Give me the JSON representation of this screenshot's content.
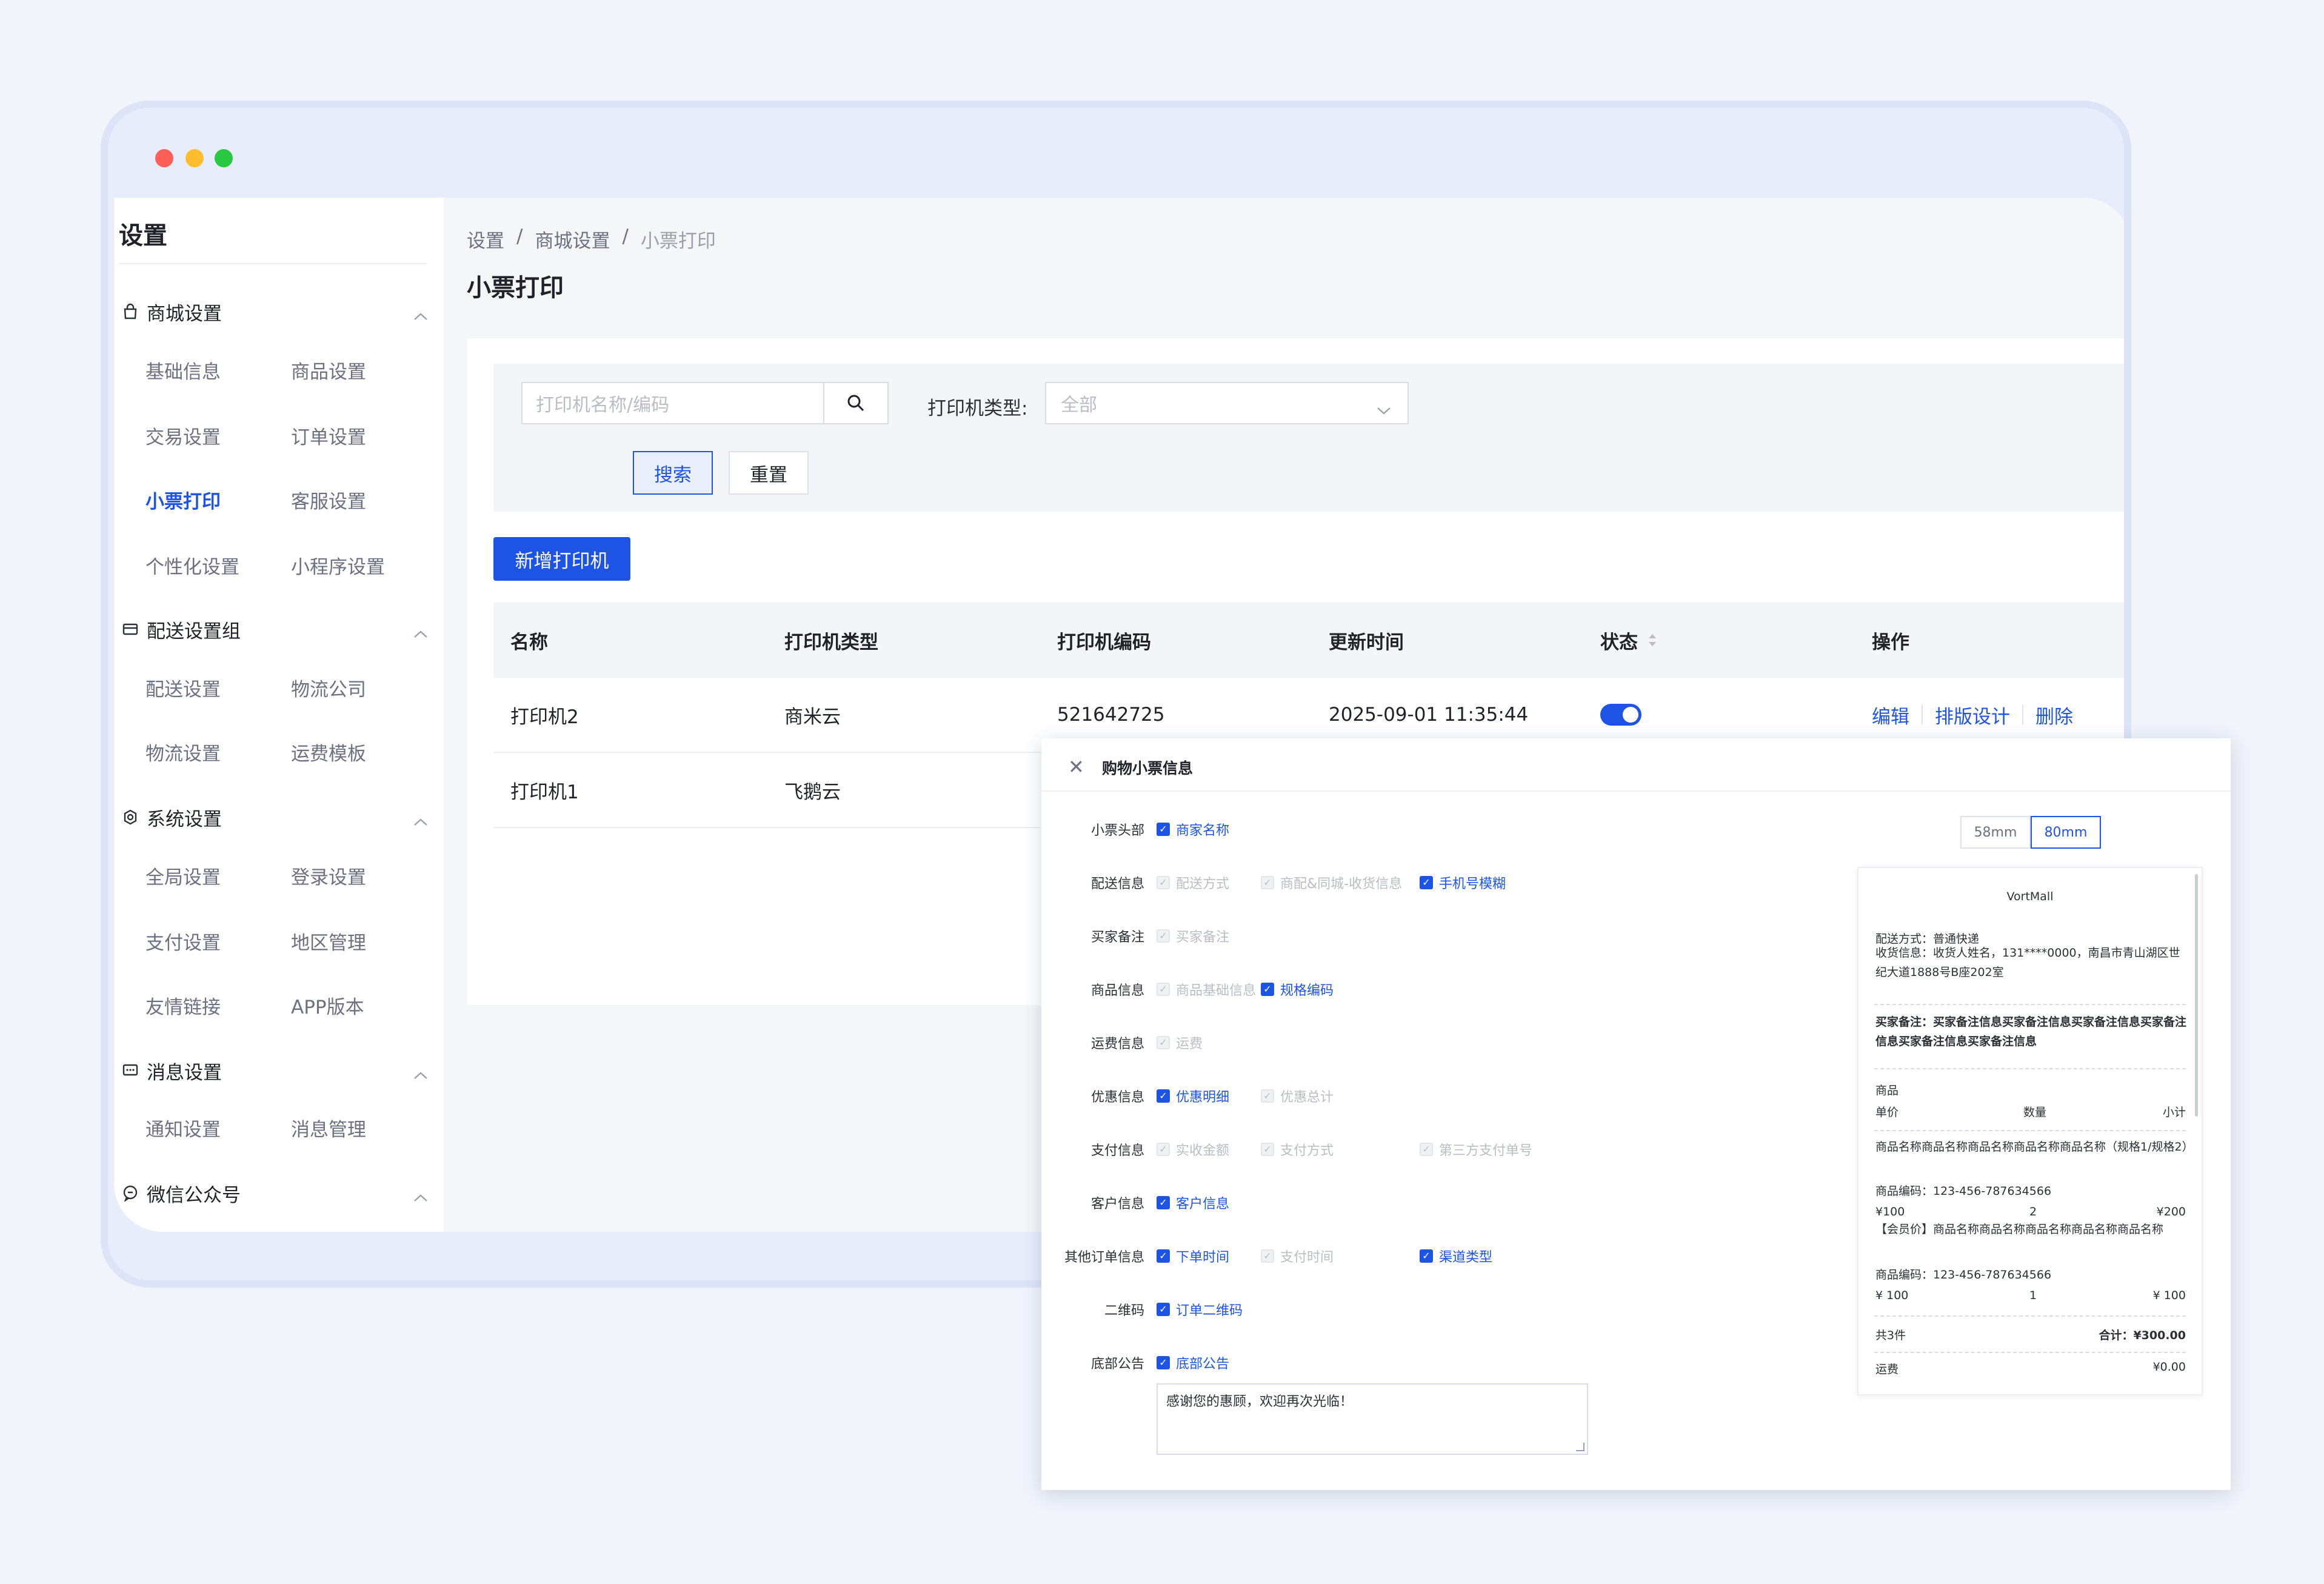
{
  "sidebar": {
    "title": "设置",
    "groups": [
      {
        "label": "商城设置",
        "items": [
          "基础信息",
          "商品设置",
          "交易设置",
          "订单设置",
          "小票打印",
          "客服设置",
          "个性化设置",
          "小程序设置"
        ]
      },
      {
        "label": "配送设置组",
        "items": [
          "配送设置",
          "物流公司",
          "物流设置",
          "运费模板"
        ]
      },
      {
        "label": "系统设置",
        "items": [
          "全局设置",
          "登录设置",
          "支付设置",
          "地区管理",
          "友情链接",
          "APP版本"
        ]
      },
      {
        "label": "消息设置",
        "items": [
          "通知设置",
          "消息管理"
        ]
      },
      {
        "label": "微信公众号",
        "items": []
      }
    ],
    "active_item": "小票打印"
  },
  "breadcrumb": [
    "设置",
    "商城设置",
    "小票打印"
  ],
  "breadcrumb_sep": "/",
  "page_title": "小票打印",
  "filter": {
    "search_placeholder": "打印机名称/编码",
    "type_label": "打印机类型:",
    "type_value": "全部",
    "search_button": "搜索",
    "reset_button": "重置"
  },
  "add_button": "新增打印机",
  "table": {
    "headers": [
      "名称",
      "打印机类型",
      "打印机编码",
      "更新时间",
      "状态",
      "操作"
    ],
    "rows": [
      {
        "name": "打印机2",
        "type": "商米云",
        "code": "521642725",
        "updated": "2025-09-01 11:35:44",
        "enabled": true
      },
      {
        "name": "打印机1",
        "type": "飞鹅云",
        "code": "",
        "updated": "",
        "enabled": null
      }
    ],
    "actions": [
      "编辑",
      "排版设计",
      "删除"
    ]
  },
  "popup": {
    "title": "购物小票信息",
    "sizes": [
      "58mm",
      "80mm"
    ],
    "active_size": "80mm",
    "rows": [
      {
        "label": "小票头部",
        "options": [
          {
            "text": "商家名称",
            "state": "on"
          }
        ]
      },
      {
        "label": "配送信息",
        "options": [
          {
            "text": "配送方式",
            "state": "dis"
          },
          {
            "text": "商配&同城-收货信息",
            "state": "dis"
          },
          {
            "text": "手机号模糊",
            "state": "on"
          }
        ]
      },
      {
        "label": "买家备注",
        "options": [
          {
            "text": "买家备注",
            "state": "dis"
          }
        ]
      },
      {
        "label": "商品信息",
        "options": [
          {
            "text": "商品基础信息",
            "state": "dis"
          },
          {
            "text": "规格编码",
            "state": "on"
          }
        ]
      },
      {
        "label": "运费信息",
        "options": [
          {
            "text": "运费",
            "state": "dis"
          }
        ]
      },
      {
        "label": "优惠信息",
        "options": [
          {
            "text": "优惠明细",
            "state": "on"
          },
          {
            "text": "优惠总计",
            "state": "dis"
          }
        ]
      },
      {
        "label": "支付信息",
        "options": [
          {
            "text": "实收金额",
            "state": "dis"
          },
          {
            "text": "支付方式",
            "state": "dis"
          },
          {
            "text": "第三方支付单号",
            "state": "dis"
          }
        ]
      },
      {
        "label": "客户信息",
        "options": [
          {
            "text": "客户信息",
            "state": "on"
          }
        ]
      },
      {
        "label": "其他订单信息",
        "options": [
          {
            "text": "下单时间",
            "state": "on"
          },
          {
            "text": "支付时间",
            "state": "dis"
          },
          {
            "text": "渠道类型",
            "state": "on"
          }
        ]
      },
      {
        "label": "二维码",
        "options": [
          {
            "text": "订单二维码",
            "state": "on"
          }
        ]
      },
      {
        "label": "底部公告",
        "options": [
          {
            "text": "底部公告",
            "state": "on"
          }
        ]
      }
    ],
    "notice_text": "感谢您的惠顾，欢迎再次光临！",
    "receipt": {
      "shop": "VortMall",
      "delivery": "配送方式：普通快递",
      "address": "收货信息：收货人姓名，131****0000，南昌市青山湖区世纪大道1888号B座202室",
      "remark": "买家备注：买家备注信息买家备注信息买家备注信息买家备注信息买家备注信息买家备注信息",
      "goods_label": "商品",
      "col_price": "单价",
      "col_qty": "数量",
      "col_subtotal": "小计",
      "item1_name": "商品名称商品名称商品名称商品名称商品名称（规格1/规格2）",
      "item1_code": "商品编码：123-456-787634566",
      "item1_price": "¥100",
      "item1_qty": "2",
      "item1_subtotal": "¥200",
      "item2_name": "【会员价】商品名称商品名称商品名称商品名称商品名称",
      "item2_code": "商品编码：123-456-787634566",
      "item2_price": "¥ 100",
      "item2_qty": "1",
      "item2_subtotal": "¥ 100",
      "count": "共3件",
      "total": "合计：¥300.00",
      "freight_label": "运费",
      "freight_value": "¥0.00"
    }
  },
  "colors": {
    "accent": "#1e54e6",
    "page_bg": "#f1f4fb"
  }
}
